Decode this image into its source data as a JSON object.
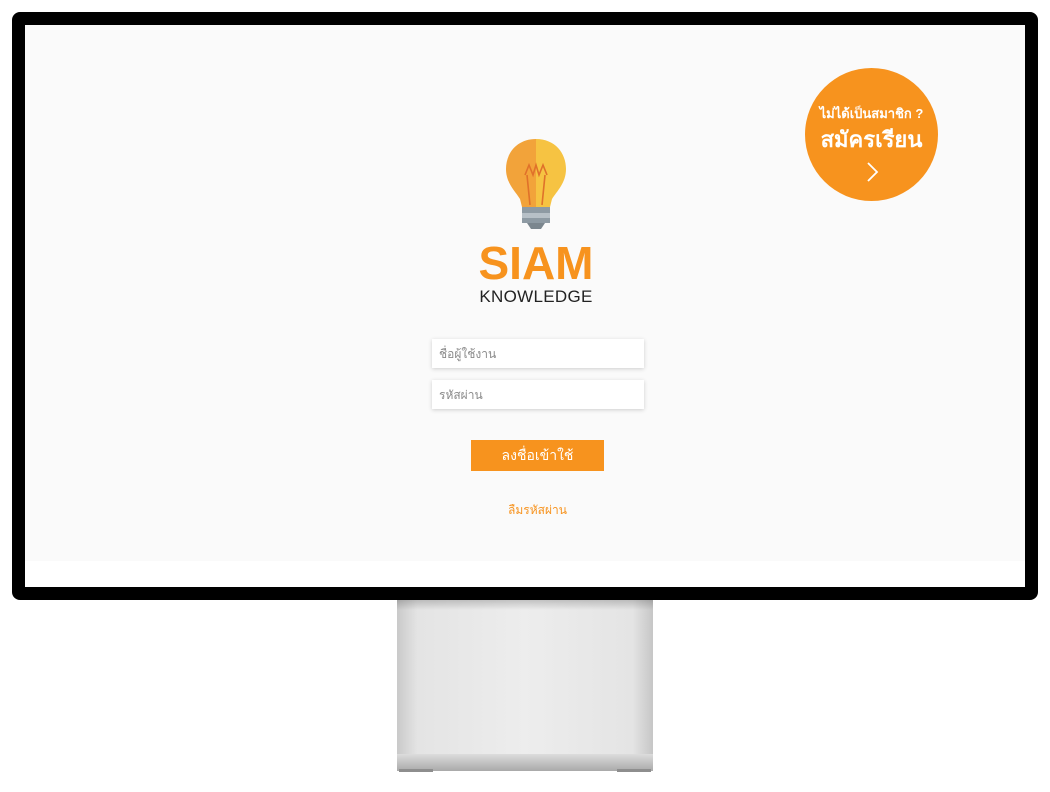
{
  "register": {
    "question": "ไม่ได้เป็นสมาชิก ?",
    "action": "สมัครเรียน",
    "arrow_icon": "chevron-right-icon"
  },
  "logo": {
    "icon": "lightbulb-icon",
    "brand": "SIAM",
    "subtitle": "KNOWLEDGE"
  },
  "form": {
    "username_placeholder": "ชื่อผู้ใช้งาน",
    "password_placeholder": "รหัสผ่าน",
    "login_label": "ลงชื่อเข้าใช้",
    "forgot_label": "ลืมรหัสผ่าน"
  },
  "colors": {
    "accent": "#f7931e",
    "bulb_light": "#f6c342",
    "bulb_dark": "#f2a33a",
    "screen_bg": "#fafafa",
    "bezel": "#000000"
  }
}
